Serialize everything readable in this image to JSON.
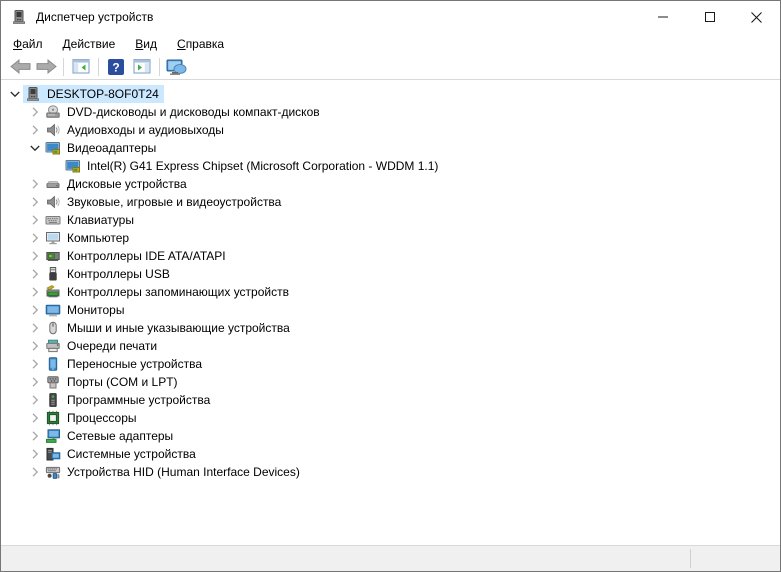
{
  "window": {
    "title": "Диспетчер устройств",
    "app_icon": "device-manager-icon",
    "controls": [
      {
        "name": "minimize-button",
        "icon": "minimize-icon"
      },
      {
        "name": "maximize-button",
        "icon": "maximize-icon"
      },
      {
        "name": "close-button",
        "icon": "close-icon"
      }
    ]
  },
  "menu": {
    "items": [
      {
        "name": "menu-file",
        "label": "Файл",
        "underline_index": 0
      },
      {
        "name": "menu-action",
        "label": "Действие",
        "underline_index": 0
      },
      {
        "name": "menu-view",
        "label": "Вид",
        "underline_index": 0
      },
      {
        "name": "menu-help",
        "label": "Справка",
        "underline_index": 0
      }
    ]
  },
  "toolbar": {
    "buttons": [
      {
        "name": "back-button",
        "icon": "back-icon"
      },
      {
        "name": "forward-button",
        "icon": "forward-icon"
      },
      {
        "separator": true
      },
      {
        "name": "console-tree-toggle-button",
        "icon": "console-tree-icon"
      },
      {
        "separator": true
      },
      {
        "name": "help-button",
        "icon": "help-icon"
      },
      {
        "name": "action-pane-toggle-button",
        "icon": "action-pane-icon"
      },
      {
        "separator": true
      },
      {
        "name": "scan-hardware-button",
        "icon": "devices-icon"
      }
    ]
  },
  "tree": {
    "items": [
      {
        "label": "DESKTOP-8OF0T24",
        "level": 0,
        "icon": "computer-icon",
        "state": "expanded",
        "selected": true
      },
      {
        "label": "DVD-дисководы и дисководы компакт-дисков",
        "level": 1,
        "icon": "dvd-drive-icon",
        "state": "collapsed"
      },
      {
        "label": "Аудиовходы и аудиовыходы",
        "level": 1,
        "icon": "audio-icon",
        "state": "collapsed"
      },
      {
        "label": "Видеоадаптеры",
        "level": 1,
        "icon": "display-adapter-icon",
        "state": "expanded"
      },
      {
        "label": "Intel(R) G41 Express Chipset (Microsoft Corporation - WDDM 1.1)",
        "level": 2,
        "icon": "display-adapter-icon",
        "state": "leaf"
      },
      {
        "label": "Дисковые устройства",
        "level": 1,
        "icon": "disk-drive-icon",
        "state": "collapsed"
      },
      {
        "label": "Звуковые, игровые и видеоустройства",
        "level": 1,
        "icon": "sound-icon",
        "state": "collapsed"
      },
      {
        "label": "Клавиатуры",
        "level": 1,
        "icon": "keyboard-icon",
        "state": "collapsed"
      },
      {
        "label": "Компьютер",
        "level": 1,
        "icon": "computer-monitor-icon",
        "state": "collapsed"
      },
      {
        "label": "Контроллеры IDE ATA/ATAPI",
        "level": 1,
        "icon": "ide-controller-icon",
        "state": "collapsed"
      },
      {
        "label": "Контроллеры USB",
        "level": 1,
        "icon": "usb-icon",
        "state": "collapsed"
      },
      {
        "label": "Контроллеры запоминающих устройств",
        "level": 1,
        "icon": "storage-controller-icon",
        "state": "collapsed"
      },
      {
        "label": "Мониторы",
        "level": 1,
        "icon": "monitor-icon",
        "state": "collapsed"
      },
      {
        "label": "Мыши и иные указывающие устройства",
        "level": 1,
        "icon": "mouse-icon",
        "state": "collapsed"
      },
      {
        "label": "Очереди печати",
        "level": 1,
        "icon": "printer-icon",
        "state": "collapsed"
      },
      {
        "label": "Переносные устройства",
        "level": 1,
        "icon": "portable-device-icon",
        "state": "collapsed"
      },
      {
        "label": "Порты (COM и LPT)",
        "level": 1,
        "icon": "port-icon",
        "state": "collapsed"
      },
      {
        "label": "Программные устройства",
        "level": 1,
        "icon": "software-device-icon",
        "state": "collapsed"
      },
      {
        "label": "Процессоры",
        "level": 1,
        "icon": "processor-icon",
        "state": "collapsed"
      },
      {
        "label": "Сетевые адаптеры",
        "level": 1,
        "icon": "network-adapter-icon",
        "state": "collapsed"
      },
      {
        "label": "Системные устройства",
        "level": 1,
        "icon": "system-device-icon",
        "state": "collapsed"
      },
      {
        "label": "Устройства HID (Human Interface Devices)",
        "level": 1,
        "icon": "hid-icon",
        "state": "collapsed"
      }
    ]
  },
  "statusbar": {
    "text": ""
  },
  "colors": {
    "selection_highlight": "#cce8ff",
    "window_border": "#767676",
    "statusbar_bg": "#f0f0f0",
    "help_button_blue": "#2b4d9e",
    "toolbar_separator": "#d6d6d6"
  }
}
